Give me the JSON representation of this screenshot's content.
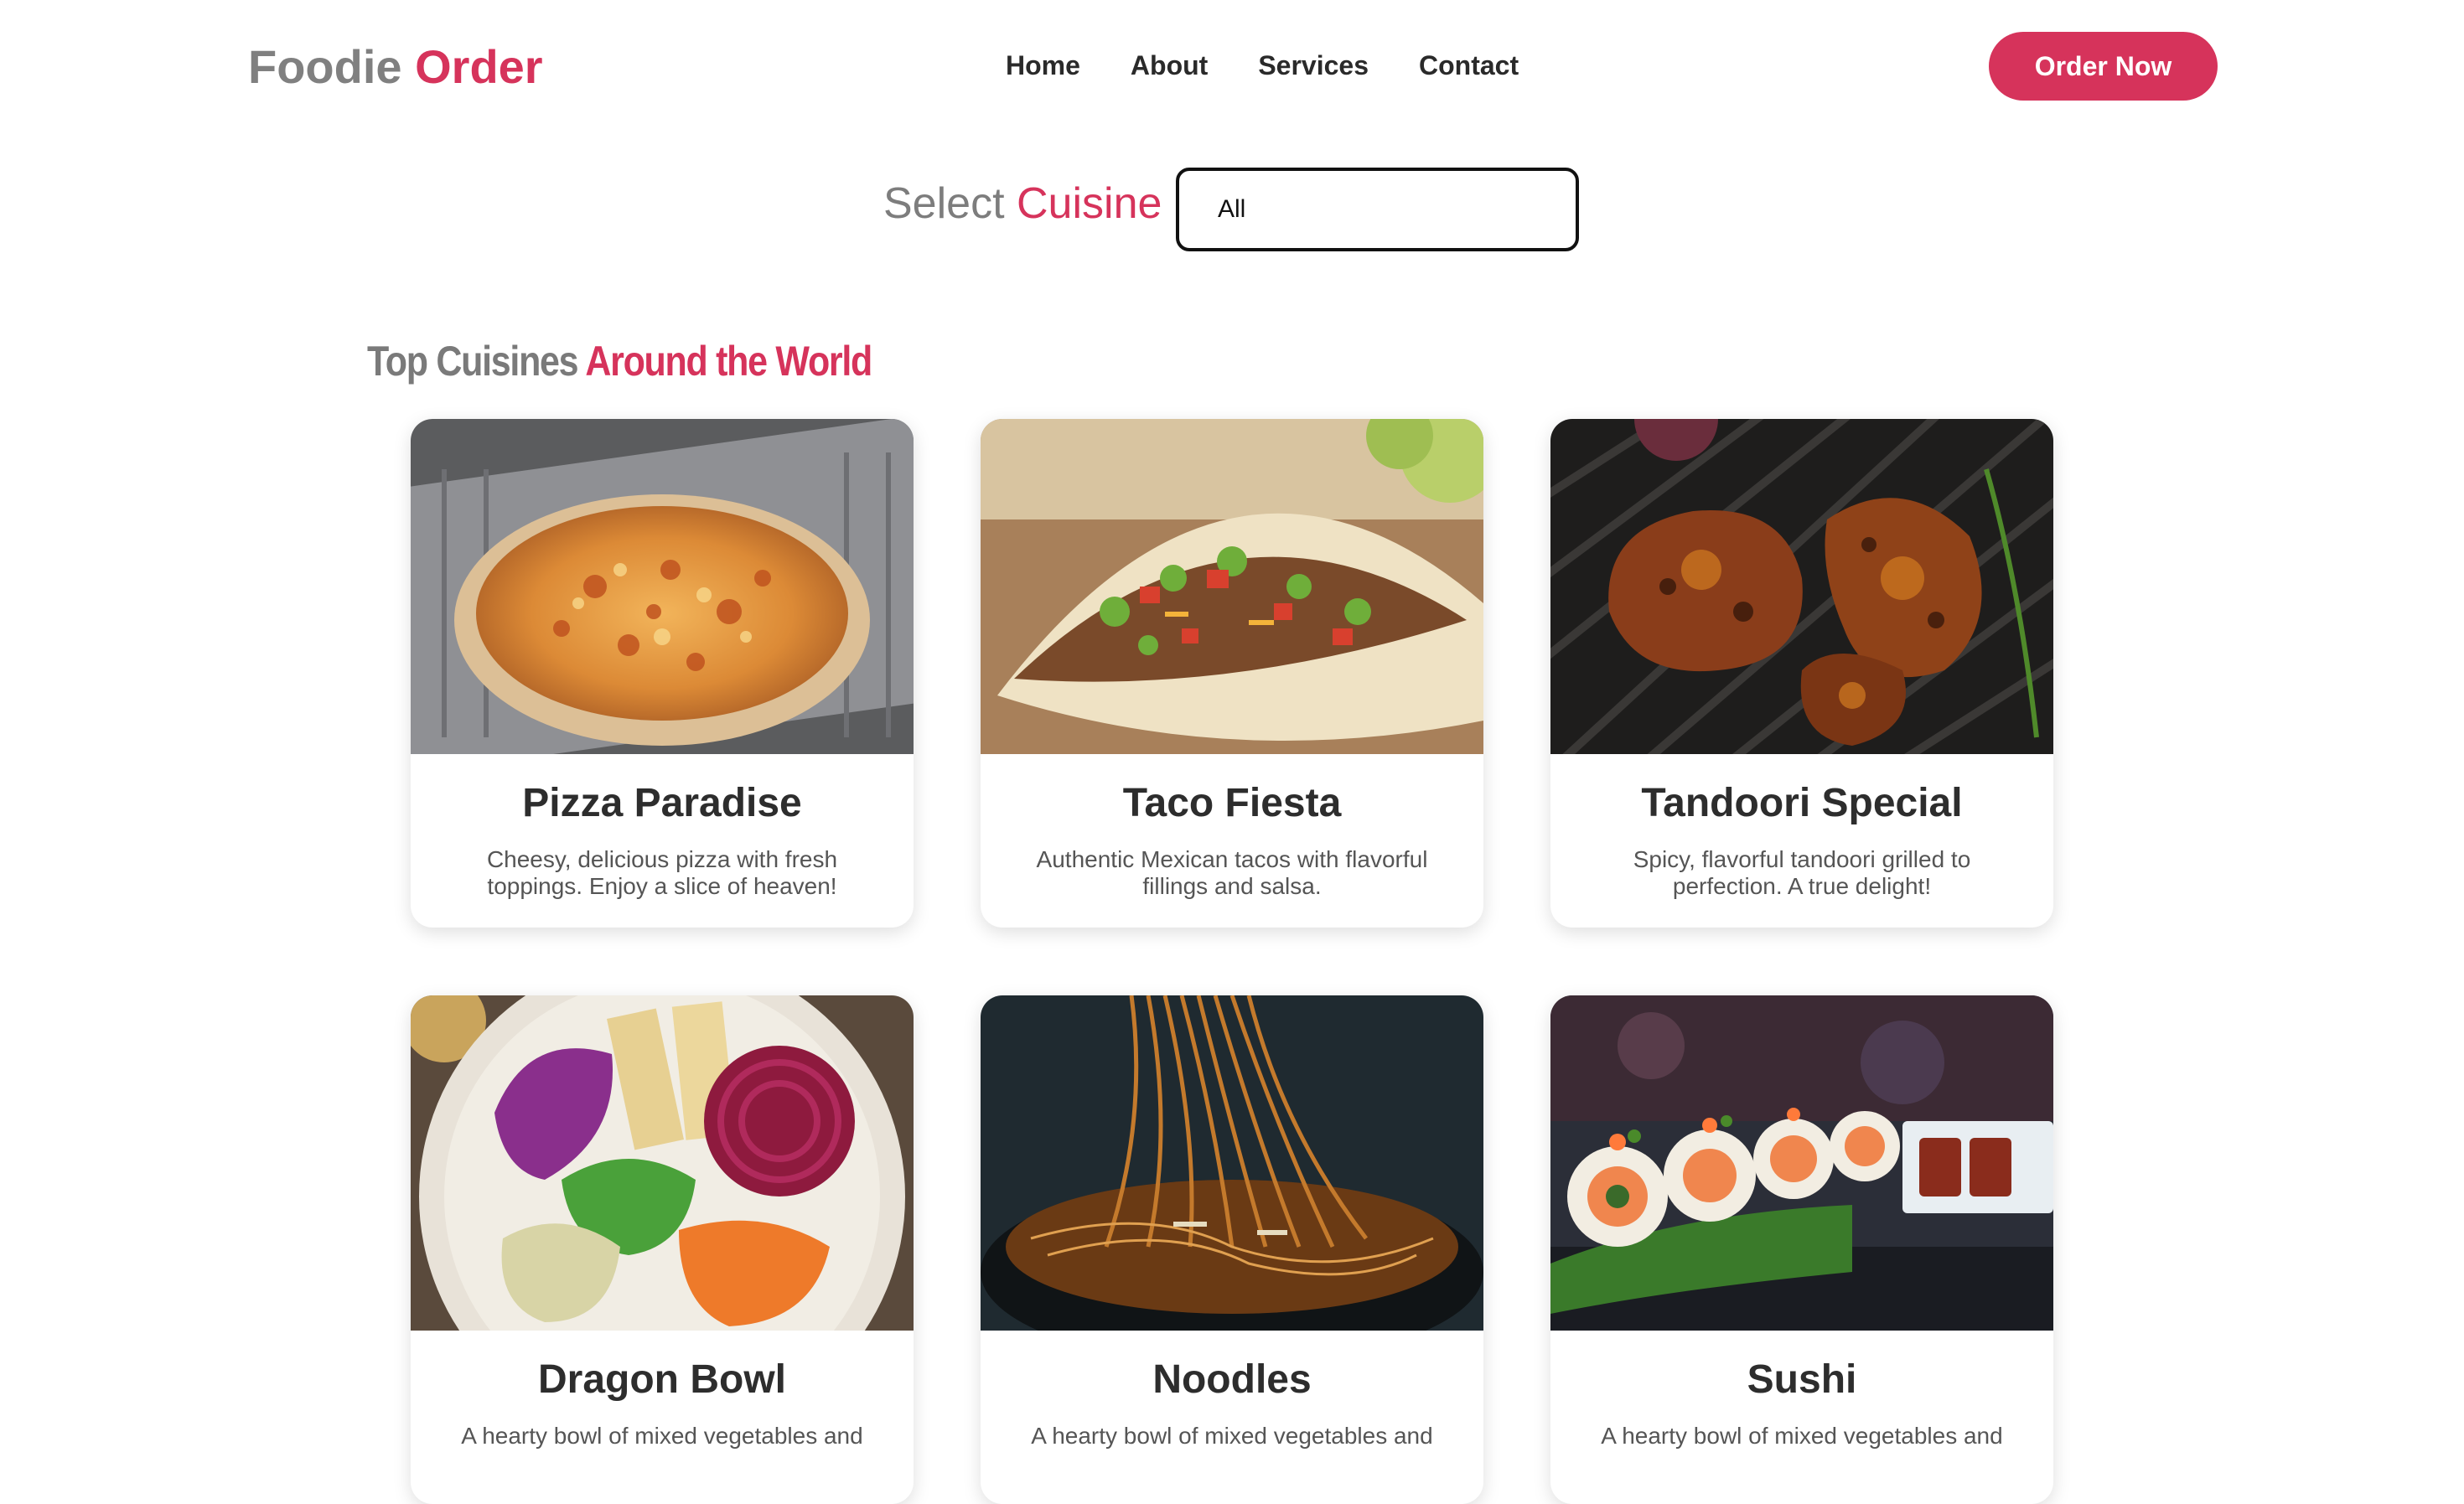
{
  "brand": {
    "part1": "Foodie",
    "part2": "Order",
    "accent_color": "#d6335b"
  },
  "nav": {
    "items": [
      "Home",
      "About",
      "Services",
      "Contact"
    ]
  },
  "header": {
    "cta_label": "Order Now"
  },
  "filter": {
    "label_part1": "Select",
    "label_part2": "Cuisine",
    "selected": "All"
  },
  "section": {
    "title_part1": "Top Cuisines",
    "title_part2": "Around the World"
  },
  "cards": [
    {
      "title": "Pizza Paradise",
      "description": "Cheesy, delicious pizza with fresh toppings. Enjoy a slice of heaven!",
      "image": "pizza-photo"
    },
    {
      "title": "Taco Fiesta",
      "description": "Authentic Mexican tacos with flavorful fillings and salsa.",
      "image": "taco-photo"
    },
    {
      "title": "Tandoori Special",
      "description": "Spicy, flavorful tandoori grilled to perfection. A true delight!",
      "image": "tandoori-chicken-photo"
    },
    {
      "title": "Dragon Bowl",
      "description": "A hearty bowl of mixed vegetables and",
      "image": "veggie-bowl-photo"
    },
    {
      "title": "Noodles",
      "description": "A hearty bowl of mixed vegetables and",
      "image": "noodles-photo"
    },
    {
      "title": "Sushi",
      "description": "A hearty bowl of mixed vegetables and",
      "image": "sushi-photo"
    }
  ]
}
